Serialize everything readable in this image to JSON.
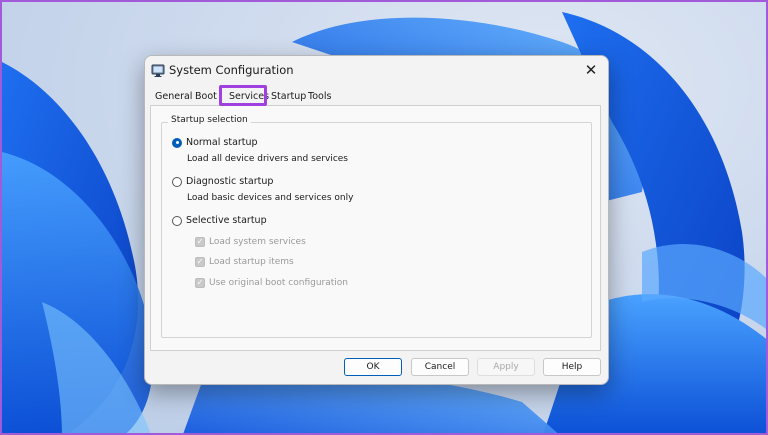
{
  "window": {
    "title": "System Configuration",
    "close_glyph": "✕"
  },
  "tabs": [
    {
      "label": "General",
      "active": true
    },
    {
      "label": "Boot",
      "active": false
    },
    {
      "label": "Services",
      "active": false,
      "highlighted": true
    },
    {
      "label": "Startup",
      "active": false
    },
    {
      "label": "Tools",
      "active": false
    }
  ],
  "startup_selection": {
    "legend": "Startup selection",
    "normal": {
      "label": "Normal startup",
      "description": "Load all device drivers and services",
      "checked": true
    },
    "diagnostic": {
      "label": "Diagnostic startup",
      "description": "Load basic devices and services only",
      "checked": false
    },
    "selective": {
      "label": "Selective startup",
      "checked": false,
      "options": [
        {
          "label": "Load system services",
          "checked": true,
          "disabled": true
        },
        {
          "label": "Load startup items",
          "checked": true,
          "disabled": true
        },
        {
          "label": "Use original boot configuration",
          "checked": true,
          "disabled": true
        }
      ]
    }
  },
  "buttons": {
    "ok": "OK",
    "cancel": "Cancel",
    "apply": "Apply",
    "help": "Help"
  },
  "colors": {
    "highlight": "#a040e0",
    "accent": "#005fb8",
    "frame": "#a25bd8"
  },
  "icons": {
    "app": "system-configuration-icon",
    "close": "close-icon"
  }
}
